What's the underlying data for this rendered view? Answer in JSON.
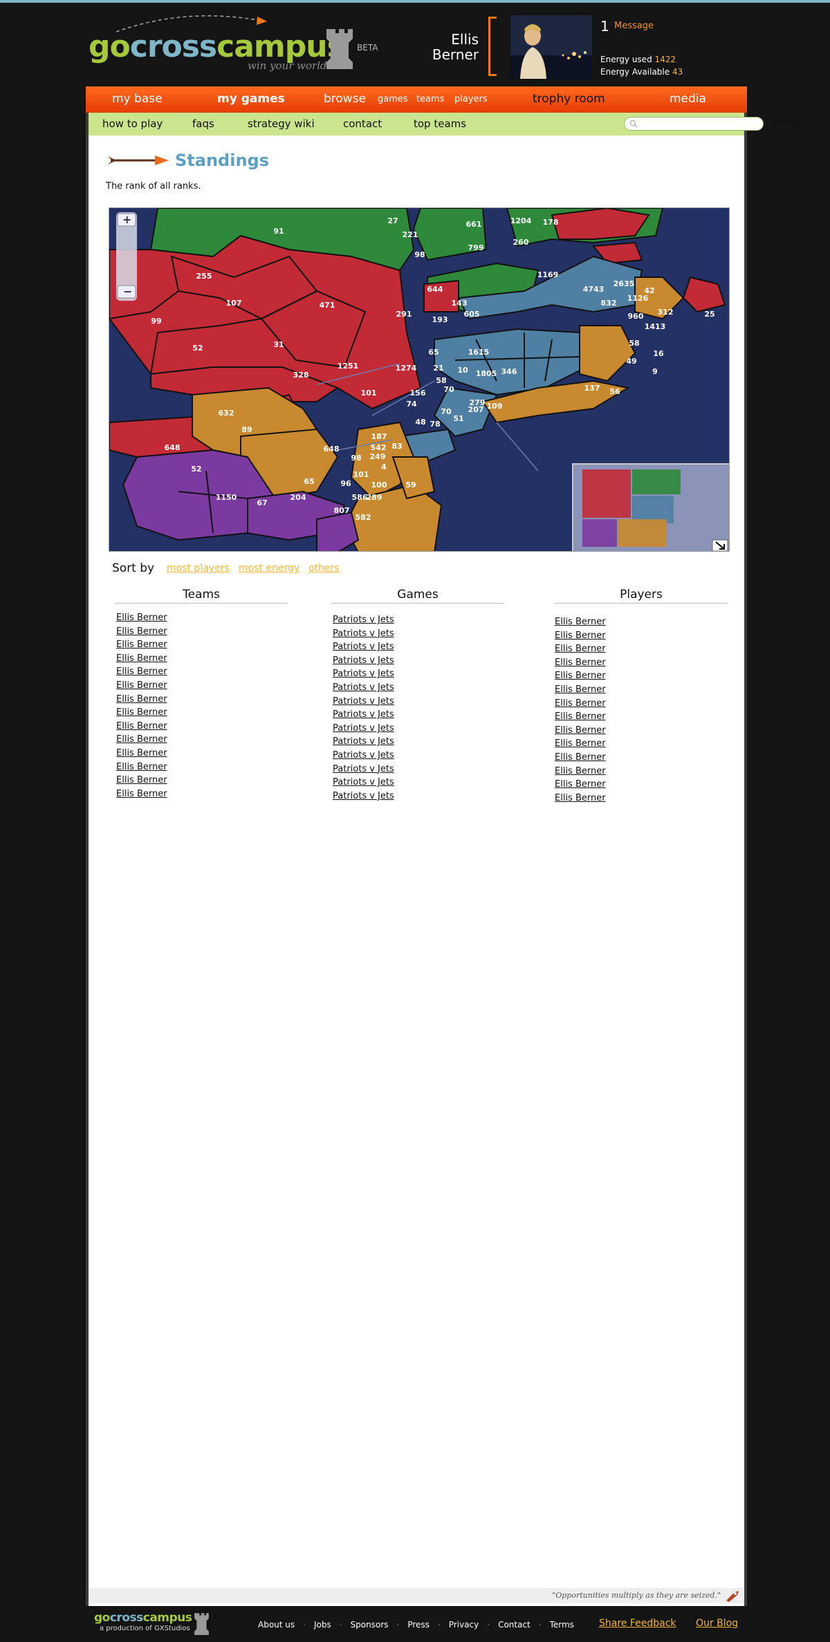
{
  "brand": {
    "logo_go": "go",
    "logo_cross": "cross",
    "logo_campus": "campus",
    "tagline": "win your world.",
    "beta": "BETA"
  },
  "user": {
    "first_name": "Ellis",
    "last_name": "Berner",
    "message_count": "1",
    "message_label": "Message",
    "energy_used_label": "Energy used",
    "energy_used": "1422",
    "energy_available_label": "Energy Available",
    "energy_available": "43"
  },
  "nav": {
    "my_base": "my base",
    "my_games": "my games",
    "browse": "browse",
    "games": "games",
    "teams": "teams",
    "players": "players",
    "trophy_room": "trophy room",
    "media": "media"
  },
  "subnav": {
    "how_to_play": "how to play",
    "faqs": "faqs",
    "strategy_wiki": "strategy wiki",
    "contact": "contact",
    "top_teams": "top teams",
    "search_placeholder": "",
    "search_button": "search"
  },
  "page": {
    "title": "Standings",
    "subtitle": "The rank of all ranks."
  },
  "map": {
    "labels": [
      "27",
      "221",
      "98",
      "661",
      "1204",
      "178",
      "799",
      "260",
      "91",
      "255",
      "107",
      "471",
      "1169",
      "644",
      "4743",
      "2635",
      "42",
      "143",
      "832",
      "1126",
      "291",
      "193",
      "605",
      "960",
      "312",
      "25",
      "1413",
      "99",
      "52",
      "31",
      "58",
      "65",
      "1615",
      "16",
      "1274",
      "21",
      "10",
      "1805",
      "346",
      "49",
      "9",
      "328",
      "1251",
      "58",
      "70",
      "137",
      "56",
      "101",
      "156",
      "279",
      "74",
      "70",
      "207",
      "109",
      "632",
      "89",
      "51",
      "48",
      "78",
      "648",
      "187",
      "83",
      "542",
      "648",
      "249",
      "98",
      "52",
      "101",
      "4",
      "59",
      "65",
      "96",
      "100",
      "289",
      "1150",
      "67",
      "204",
      "586",
      "807",
      "582"
    ]
  },
  "sort": {
    "label": "Sort by",
    "options": [
      "most players",
      "most energy",
      "others"
    ]
  },
  "columns": {
    "teams_header": "Teams",
    "games_header": "Games",
    "players_header": "Players",
    "teams": [
      "Ellis Berner",
      "Ellis Berner",
      "Ellis Berner",
      "Ellis Berner",
      "Ellis Berner",
      "Ellis Berner",
      "Ellis Berner",
      "Ellis Berner",
      "Ellis Berner",
      "Ellis Berner",
      "Ellis Berner",
      "Ellis Berner",
      "Ellis Berner",
      "Ellis Berner"
    ],
    "games": [
      "Patriots v Jets",
      "Patriots v Jets",
      "Patriots v Jets",
      "Patriots v Jets",
      "Patriots v Jets",
      "Patriots v Jets",
      "Patriots v Jets",
      "Patriots v Jets",
      "Patriots v Jets",
      "Patriots v Jets",
      "Patriots v Jets",
      "Patriots v Jets",
      "Patriots v Jets",
      "Patriots v Jets"
    ],
    "players": [
      "Ellis Berner",
      "Ellis Berner",
      "Ellis Berner",
      "Ellis Berner",
      "Ellis Berner",
      "Ellis Berner",
      "Ellis Berner",
      "Ellis Berner",
      "Ellis Berner",
      "Ellis Berner",
      "Ellis Berner",
      "Ellis Berner",
      "Ellis Berner",
      "Ellis Berner"
    ]
  },
  "quote": "\"Opportunities multiply as they are seized.\"",
  "footer": {
    "logo_go": "go",
    "logo_cross": "cross",
    "logo_campus": "campus",
    "production": "a production of GXStudios",
    "links": [
      "About us",
      "Jobs",
      "Sponsors",
      "Press",
      "Privacy",
      "Contact",
      "Terms"
    ],
    "share_feedback": "Share Feedback",
    "our_blog": "Our Blog"
  },
  "colors": {
    "accent_orange": "#ff6a1e",
    "subnav_green": "#cbe58f",
    "title_blue": "#5ba1c4",
    "link_gold": "#f7b731",
    "team_red": "#c22a36",
    "team_green": "#2e8a3a",
    "team_blue": "#4f7fa2",
    "team_orange": "#c98a2f",
    "team_purple": "#7b3aa0",
    "water": "#243165"
  }
}
